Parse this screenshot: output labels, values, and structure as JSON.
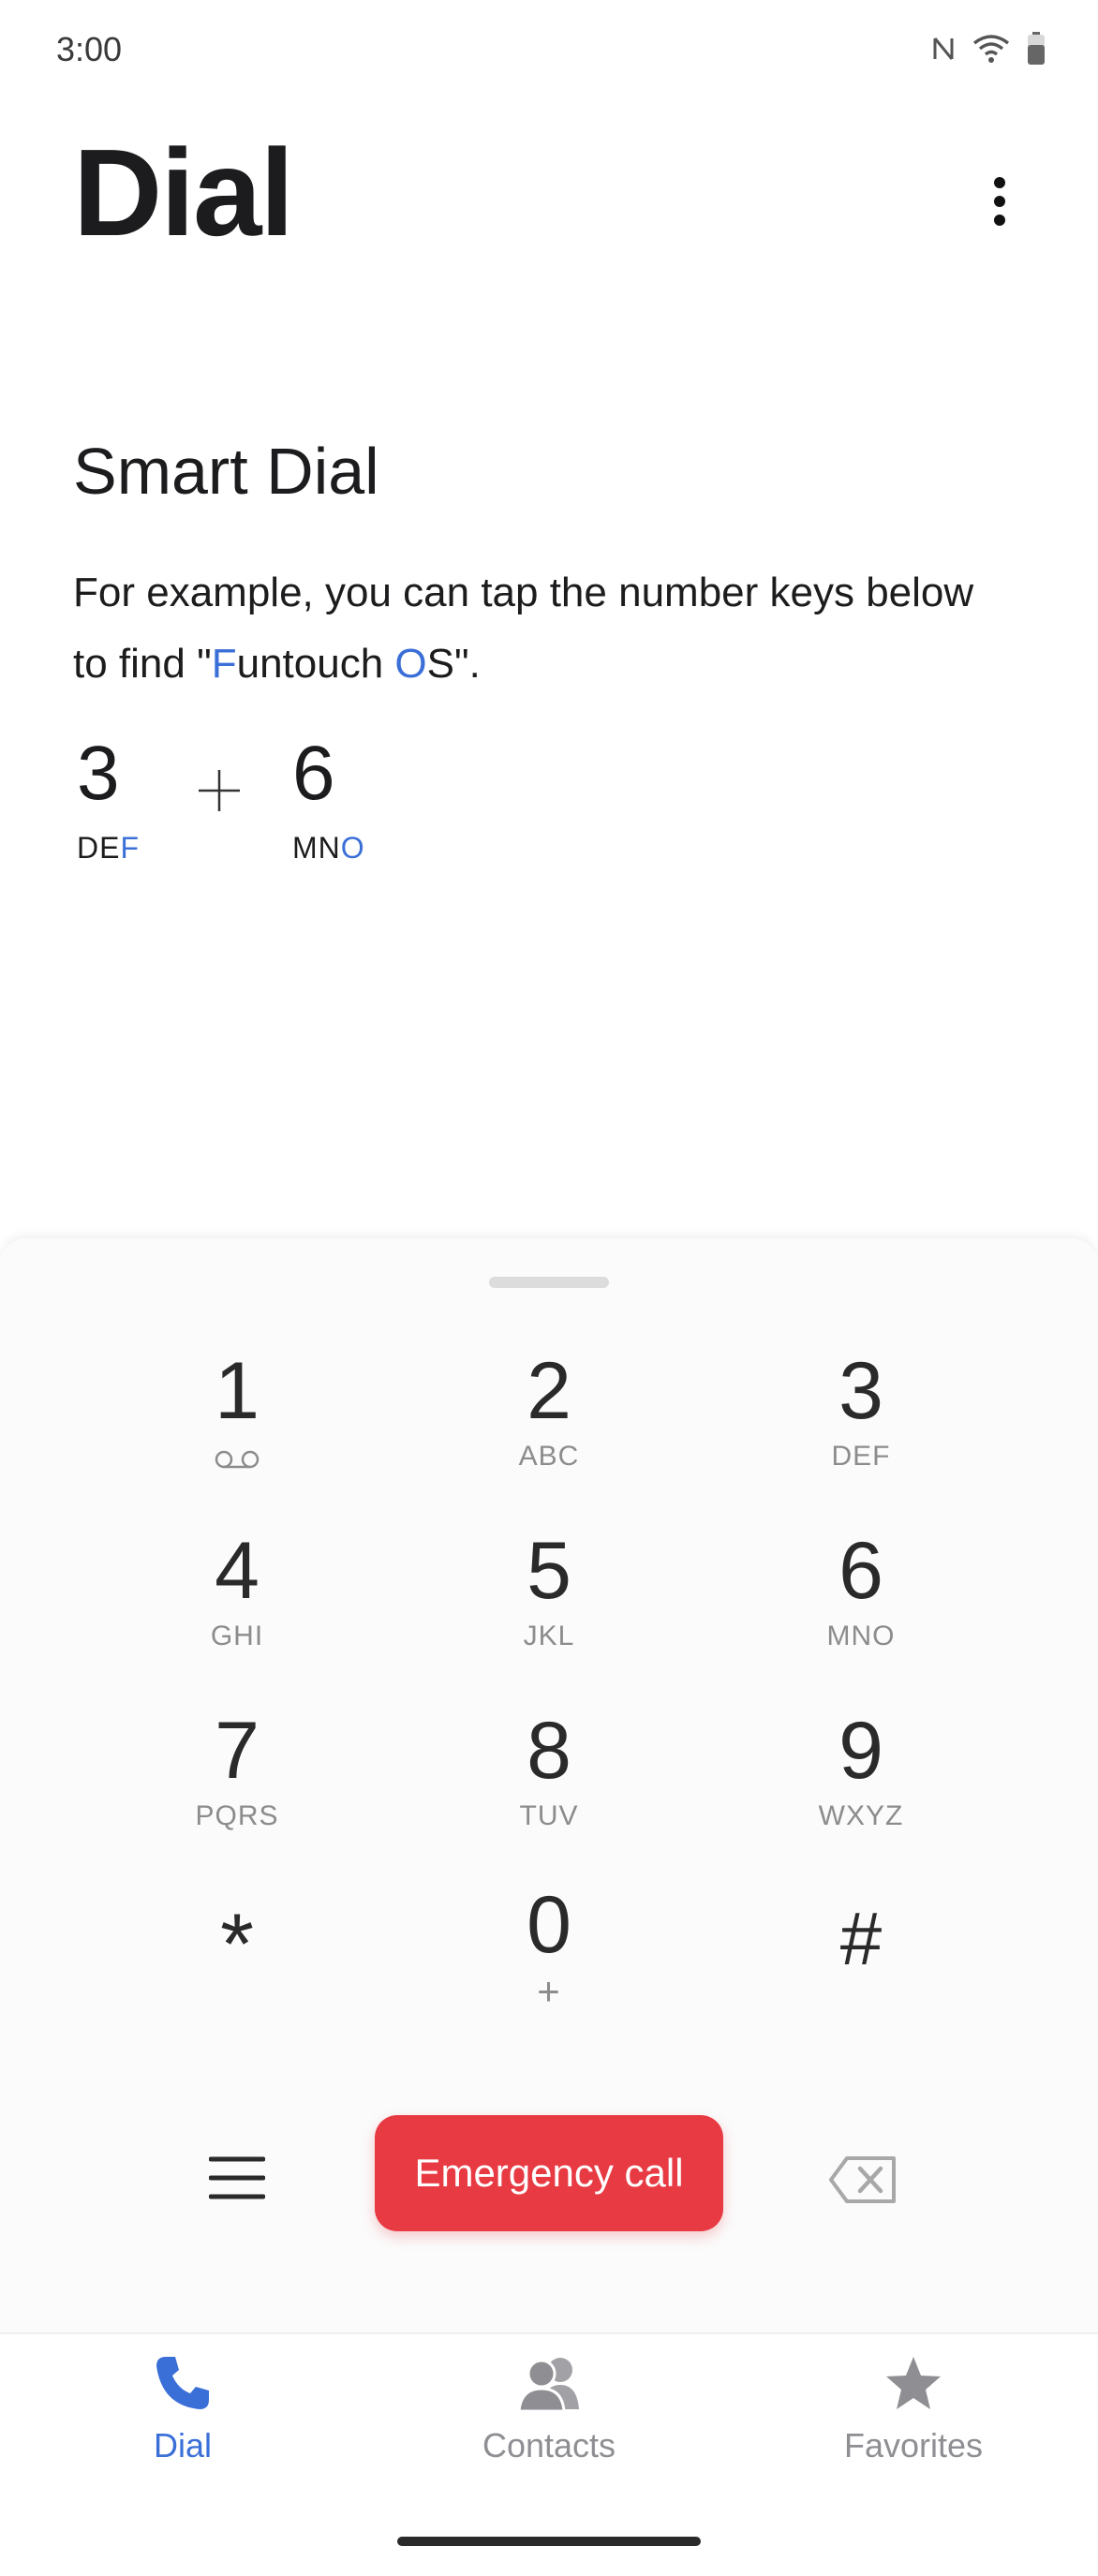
{
  "status_bar": {
    "time": "3:00"
  },
  "header": {
    "title": "Dial"
  },
  "smart_dial": {
    "title": "Smart Dial",
    "desc_line1": "For example, you can tap the number keys below",
    "desc_line2_pre": "to find \"",
    "desc_hl1": "F",
    "desc_mid": "untouch ",
    "desc_hl2": "O",
    "desc_post": "S\".",
    "example": [
      {
        "digit": "3",
        "letters_plain": "DE",
        "letters_hl": "F"
      },
      {
        "digit": "6",
        "letters_plain": "MN",
        "letters_hl": "O"
      }
    ]
  },
  "keypad": {
    "keys": [
      {
        "num": "1",
        "sub": ""
      },
      {
        "num": "2",
        "sub": "ABC"
      },
      {
        "num": "3",
        "sub": "DEF"
      },
      {
        "num": "4",
        "sub": "GHI"
      },
      {
        "num": "5",
        "sub": "JKL"
      },
      {
        "num": "6",
        "sub": "MNO"
      },
      {
        "num": "7",
        "sub": "PQRS"
      },
      {
        "num": "8",
        "sub": "TUV"
      },
      {
        "num": "9",
        "sub": "WXYZ"
      },
      {
        "num": "*",
        "sub": ""
      },
      {
        "num": "0",
        "sub": "+"
      },
      {
        "num": "#",
        "sub": ""
      }
    ]
  },
  "actions": {
    "emergency_label": "Emergency call"
  },
  "nav": {
    "dial_label": "Dial",
    "contacts_label": "Contacts",
    "favorites_label": "Favorites"
  },
  "colors": {
    "accent": "#3b6fd8",
    "emergency": "#e83a43",
    "inactive": "#8e8e93"
  }
}
